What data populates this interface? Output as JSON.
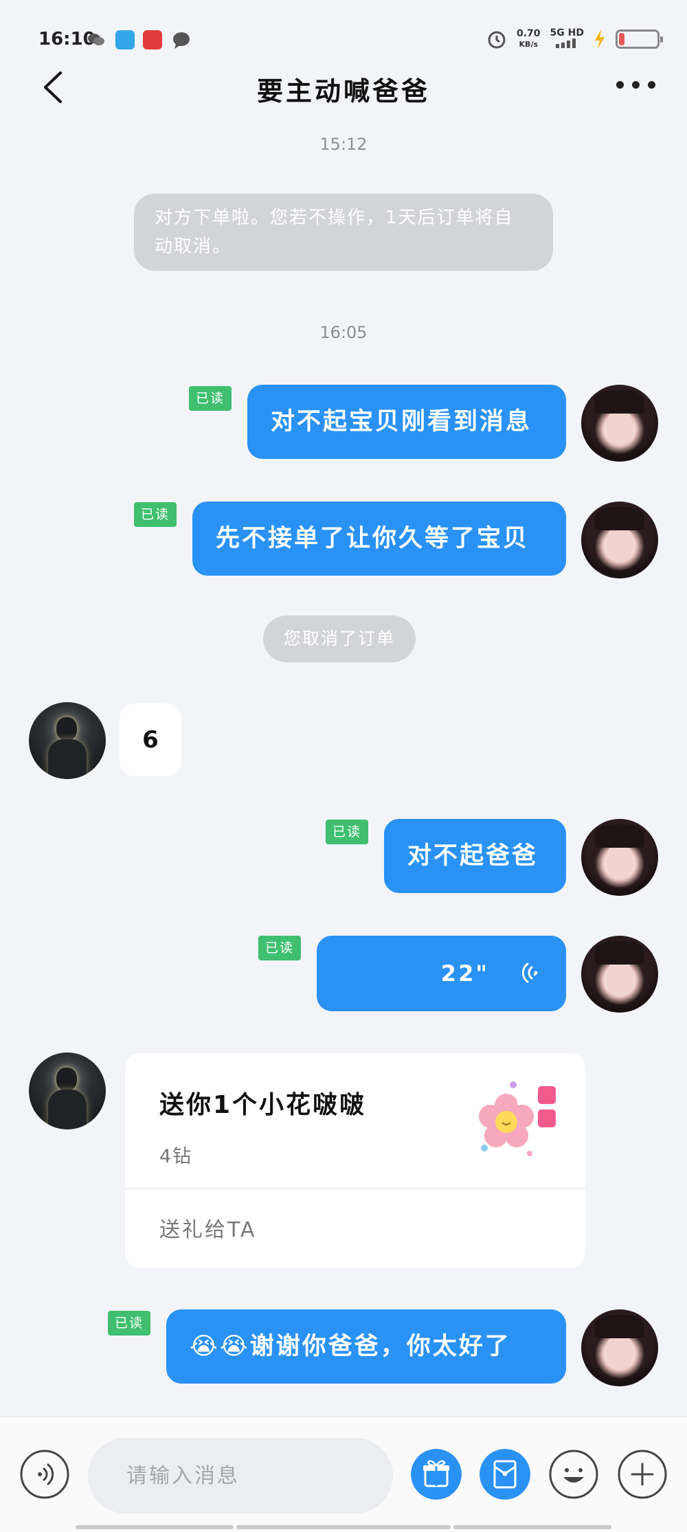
{
  "status_bar": {
    "time": "16:10",
    "net_speed_value": "0.70",
    "net_speed_unit": "KB/s",
    "network": "5G HD",
    "battery_level": 0.15,
    "icons": [
      "wechat-icon",
      "app-blue-icon",
      "app-red-icon",
      "chat-bubble-icon",
      "alarm-icon",
      "signal-icon",
      "charging-icon",
      "battery-icon"
    ]
  },
  "header": {
    "title": "要主动喊爸爸",
    "back_icon": "back-arrow-icon",
    "more_icon": "more-dots-icon"
  },
  "messages": {
    "time_1": "15:12",
    "system_notice": "对方下单啦。您若不操作，1天后订单将自动取消。",
    "time_2": "16:05",
    "out_1": "对不起宝贝刚看到消息",
    "out_2": "先不接单了让你久等了宝贝",
    "cancel_notice": "您取消了订单",
    "in_1": "6",
    "out_3": "对不起爸爸",
    "voice_duration": "22\"",
    "out_4": "😭😭谢谢你爸爸，你太好了",
    "read_label": "已读"
  },
  "gift": {
    "title": "送你1个小花啵啵",
    "price": "4钻",
    "action": "送礼给TA"
  },
  "input_bar": {
    "placeholder": "请输入消息",
    "icons": [
      "voice-icon",
      "gift-icon",
      "red-packet-icon",
      "emoji-icon",
      "plus-icon"
    ]
  },
  "colors": {
    "accent": "#2a92f5",
    "read_badge": "#3fbf6f",
    "background": "#f3f4f8"
  }
}
